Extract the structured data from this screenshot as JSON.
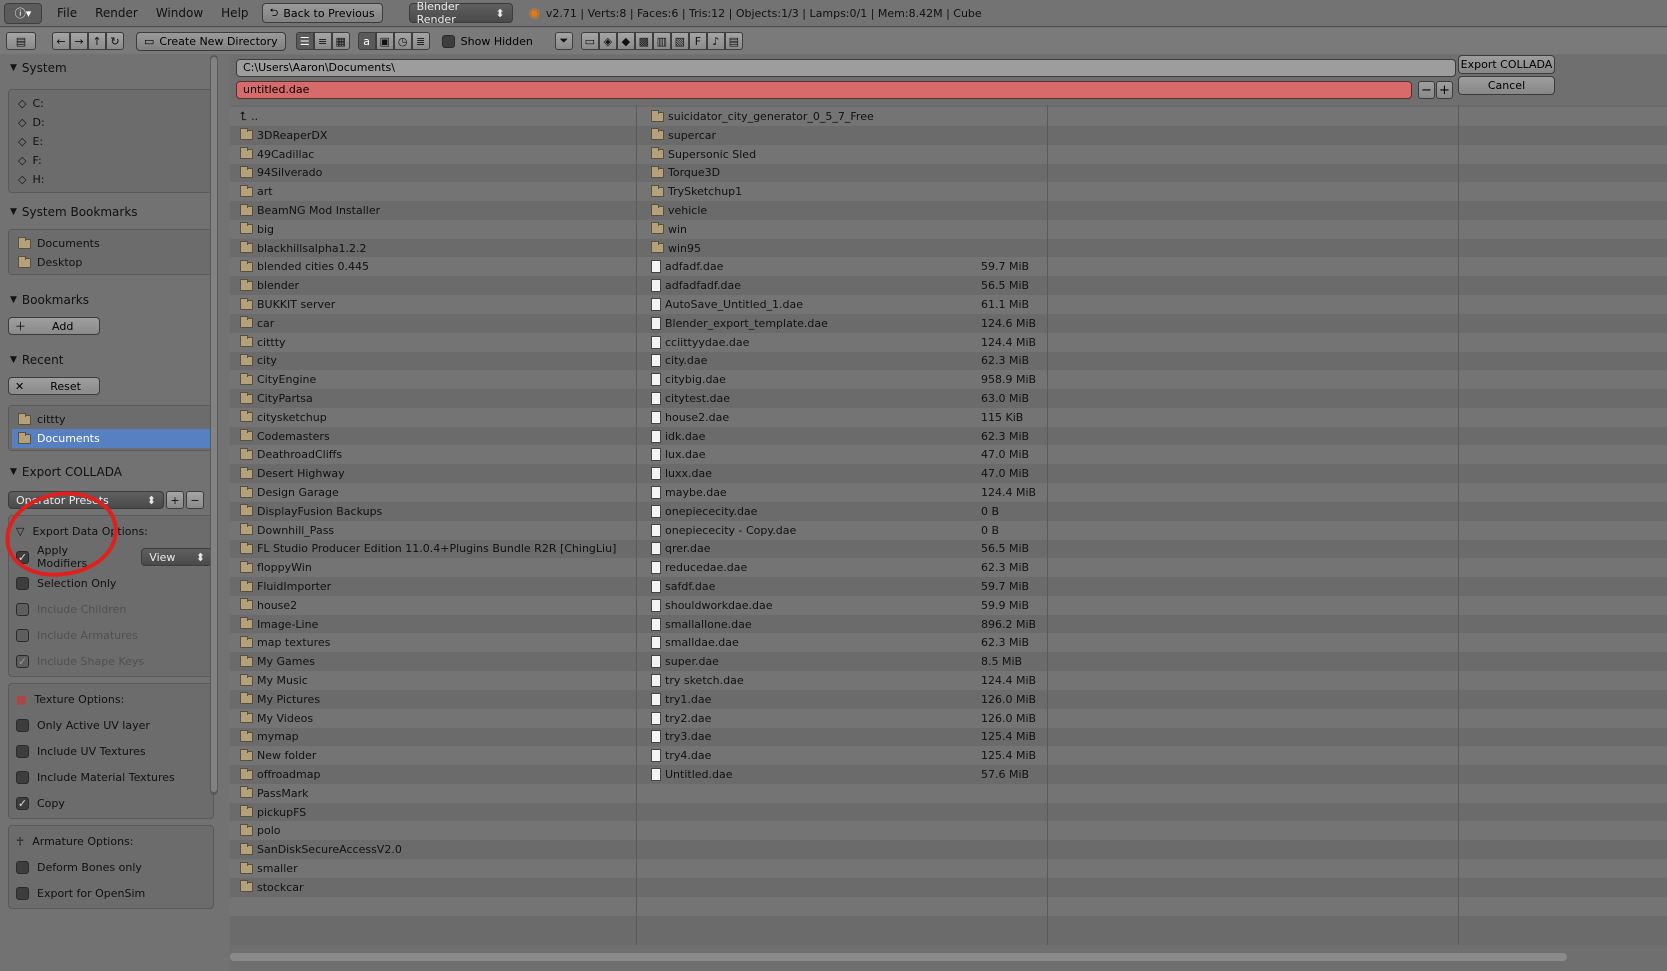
{
  "topbar": {
    "menus": [
      "File",
      "Render",
      "Window",
      "Help"
    ],
    "back_label": "Back to Previous",
    "engine": "Blender Render",
    "stats": "v2.71 | Verts:8 | Faces:6 | Tris:12 | Objects:1/3 | Lamps:0/1 | Mem:8.42M | Cube"
  },
  "toolbar": {
    "new_dir_label": "Create New Directory",
    "show_hidden_label": "Show Hidden"
  },
  "sidebar": {
    "system_title": "System",
    "drives": [
      "C:",
      "D:",
      "E:",
      "F:",
      "H:"
    ],
    "system_bookmarks_title": "System Bookmarks",
    "system_bookmarks": [
      "Documents",
      "Desktop"
    ],
    "bookmarks_title": "Bookmarks",
    "add_label": "Add",
    "recent_title": "Recent",
    "reset_label": "Reset",
    "recent_items": [
      "cittty",
      "Documents"
    ],
    "export_title": "Export COLLADA",
    "operator_presets": "Operator Presets",
    "export_data_options": "Export Data Options:",
    "apply_modifiers": "Apply Modifiers",
    "view_select": "View",
    "selection_only": "Selection Only",
    "include_children": "Include Children",
    "include_armatures": "Include Armatures",
    "include_shape_keys": "Include Shape Keys",
    "texture_options": "Texture Options:",
    "only_active_uv": "Only Active UV layer",
    "include_uv_textures": "Include UV Textures",
    "include_material_textures": "Include Material Textures",
    "copy": "Copy",
    "armature_options": "Armature Options:",
    "deform_bones_only": "Deform Bones only",
    "export_opensim": "Export for OpenSim"
  },
  "main": {
    "path": "C:\\Users\\Aaron\\Documents\\",
    "filename": "untitled.dae",
    "export_button": "Export COLLADA",
    "cancel_button": "Cancel",
    "col1": [
      "..",
      "3DReaperDX",
      "49Cadillac",
      "94Silverado",
      "art",
      "BeamNG Mod Installer",
      "big",
      "blackhillsalpha1.2.2",
      "blended cities 0.445",
      "blender",
      "BUKKIT server",
      "car",
      "cittty",
      "city",
      "CityEngine",
      "CityPartsa",
      "citysketchup",
      "Codemasters",
      "DeathroadCliffs",
      "Desert Highway",
      "Design Garage",
      "DisplayFusion Backups",
      "Downhill_Pass",
      "FL Studio Producer Edition 11.0.4+Plugins Bundle R2R [ChingLiu]",
      "floppyWin",
      "FluidImporter",
      "house2",
      "Image-Line",
      "map textures",
      "My Games",
      "My Music",
      "My Pictures",
      "My Videos",
      "mymap",
      "New folder",
      "offroadmap",
      "PassMark",
      "pickupFS",
      "polo",
      "SanDiskSecureAccessV2.0",
      "smaller",
      "stockcar"
    ],
    "col2_folders": [
      "suicidator_city_generator_0_5_7_Free",
      "supercar",
      "Supersonic Sled",
      "Torque3D",
      "TrySketchup1",
      "vehicle",
      "win",
      "win95"
    ],
    "col2_files": [
      {
        "name": "adfadf.dae",
        "size": "59.7 MiB"
      },
      {
        "name": "adfadfadf.dae",
        "size": "56.5 MiB"
      },
      {
        "name": "AutoSave_Untitled_1.dae",
        "size": "61.1 MiB"
      },
      {
        "name": "Blender_export_template.dae",
        "size": "124.6 MiB"
      },
      {
        "name": "cciittyydae.dae",
        "size": "124.4 MiB"
      },
      {
        "name": "city.dae",
        "size": "62.3 MiB"
      },
      {
        "name": "citybig.dae",
        "size": "958.9 MiB"
      },
      {
        "name": "citytest.dae",
        "size": "63.0 MiB"
      },
      {
        "name": "house2.dae",
        "size": "115 KiB"
      },
      {
        "name": "idk.dae",
        "size": "62.3 MiB"
      },
      {
        "name": "lux.dae",
        "size": "47.0 MiB"
      },
      {
        "name": "luxx.dae",
        "size": "47.0 MiB"
      },
      {
        "name": "maybe.dae",
        "size": "124.4 MiB"
      },
      {
        "name": "onepiececity.dae",
        "size": "0 B"
      },
      {
        "name": "onepiececity - Copy.dae",
        "size": "0 B"
      },
      {
        "name": "qrer.dae",
        "size": "56.5 MiB"
      },
      {
        "name": "reducedae.dae",
        "size": "62.3 MiB"
      },
      {
        "name": "safdf.dae",
        "size": "59.7 MiB"
      },
      {
        "name": "shouldworkdae.dae",
        "size": "59.9 MiB"
      },
      {
        "name": "smallallone.dae",
        "size": "896.2 MiB"
      },
      {
        "name": "smalldae.dae",
        "size": "62.3 MiB"
      },
      {
        "name": "super.dae",
        "size": "8.5 MiB"
      },
      {
        "name": "try sketch.dae",
        "size": "124.4 MiB"
      },
      {
        "name": "try1.dae",
        "size": "126.0 MiB"
      },
      {
        "name": "try2.dae",
        "size": "126.0 MiB"
      },
      {
        "name": "try3.dae",
        "size": "125.4 MiB"
      },
      {
        "name": "try4.dae",
        "size": "125.4 MiB"
      },
      {
        "name": "Untitled.dae",
        "size": "57.6 MiB"
      }
    ]
  },
  "colors": {
    "selected": "#5680c2",
    "filename_field": "#d76a6a",
    "annotation": "#e0201e"
  }
}
